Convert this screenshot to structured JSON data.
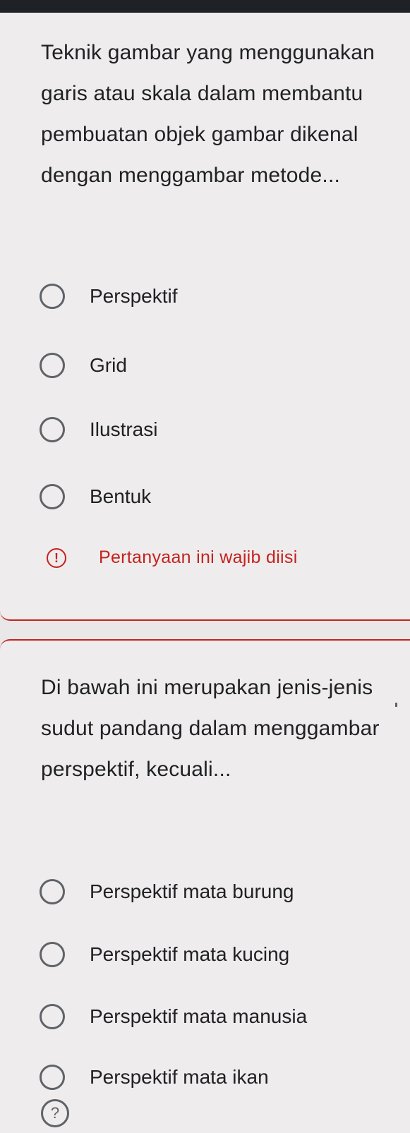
{
  "question1": {
    "text": "Teknik gambar yang menggunakan garis atau skala dalam membantu pembuatan objek gambar dikenal dengan menggambar metode...",
    "options": [
      "Perspektif",
      "Grid",
      "Ilustrasi",
      "Bentuk"
    ],
    "required_message": "Pertanyaan ini wajib diisi"
  },
  "question2": {
    "text": "Di bawah ini merupakan jenis-jenis sudut pandang dalam menggambar perspektif, kecuali...",
    "options": [
      "Perspektif mata burung",
      "Perspektif mata kucing",
      "Perspektif mata manusia",
      "Perspektif mata ikan"
    ]
  },
  "icons": {
    "radio": "radio-unchecked-icon",
    "alert": "alert-circle-icon",
    "help": "help-circle-icon"
  },
  "colors": {
    "error": "#c5221f",
    "radio_border": "#5f6368",
    "card_background": "#eeecec"
  }
}
